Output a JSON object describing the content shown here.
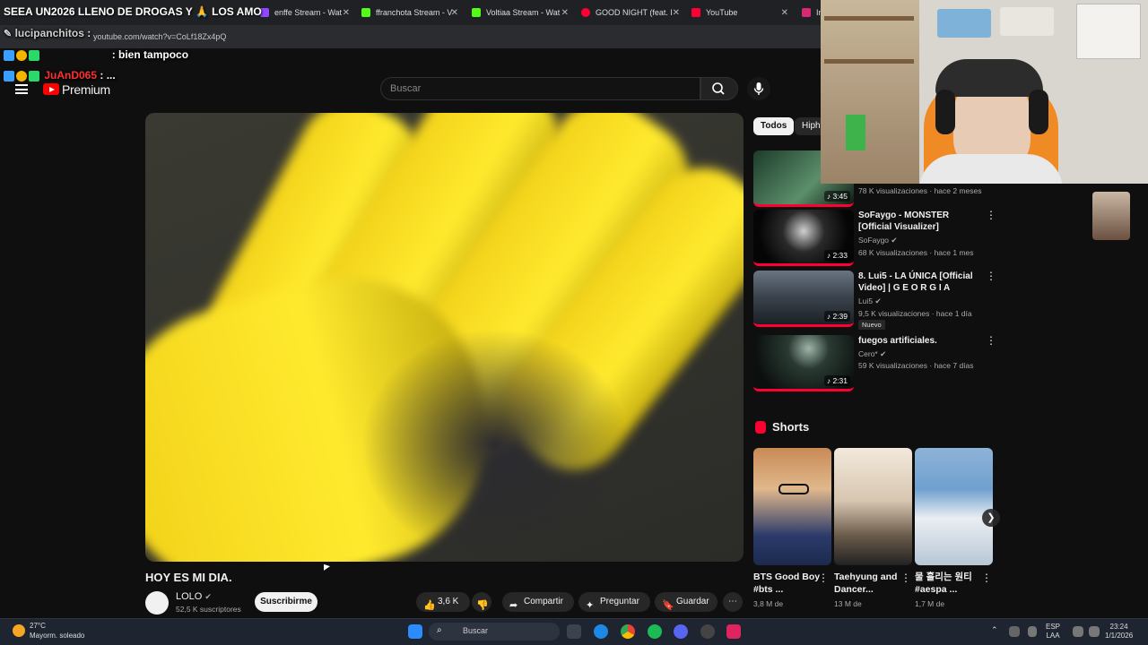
{
  "browser": {
    "stream_title": "SEEA UN2026 LLENO DE DROGAS Y 🙏 LOS AMO",
    "tabs": [
      {
        "label": "enffe Stream - Wat",
        "color": "#9146ff"
      },
      {
        "label": "ffranchota Stream - V",
        "color": "#53fc18"
      },
      {
        "label": "Voltiaa Stream - Wat",
        "color": "#53fc18"
      },
      {
        "label": "GOOD NIGHT (feat. I",
        "color": "#ff0033"
      },
      {
        "label": "YouTube",
        "color": "#ff0033"
      },
      {
        "label": "In",
        "color": "#d62976"
      }
    ],
    "url": "youtube.com/watch?v=CoLf18Zx4pQ"
  },
  "chat": [
    {
      "user": "lucipanchitos",
      "message": ":",
      "user_color": "#d0d0d0"
    },
    {
      "user": "",
      "message": ": bien tampoco",
      "user_color": "#ff3030"
    },
    {
      "user": "JuAnD065",
      "message": ": ...",
      "user_color": "#ff3030"
    }
  ],
  "header": {
    "logo_label": "Premium",
    "search_placeholder": "Buscar"
  },
  "video": {
    "title": "HOY ES MI DIA.",
    "channel": "LOLO",
    "subscribers": "52,5 K suscriptores",
    "subscribe_label": "Suscribirme",
    "likes": "3,6 K",
    "share_label": "Compartir",
    "ask_label": "Preguntar",
    "save_label": "Guardar"
  },
  "chips": [
    "Todos",
    "Hiph"
  ],
  "recommendations": [
    {
      "title": "",
      "channel": "",
      "meta": "78 K visualizaciones · hace 2 meses",
      "duration": "3:45"
    },
    {
      "title": "SoFaygo - MONSTER [Official Visualizer]",
      "channel": "SoFaygo",
      "meta": "68 K visualizaciones · hace 1 mes",
      "duration": "2:33"
    },
    {
      "title": "8. Lui5 - LA ÚNICA [Official Video] | G E O R G I A",
      "channel": "Lui5",
      "meta": "9,5 K visualizaciones · hace 1 día",
      "duration": "2:39",
      "badge": "Nuevo"
    },
    {
      "title": "fuegos artificiales.",
      "channel": "Cero*",
      "meta": "59 K visualizaciones · hace 7 días",
      "duration": "2:31"
    }
  ],
  "shorts": {
    "heading": "Shorts",
    "items": [
      {
        "title": "BTS Good Boy #bts ...",
        "views": "3,8 M de"
      },
      {
        "title": "Taehyung and Dancer...",
        "views": "13 M de"
      },
      {
        "title": "물 흘리는 원티 #aespa ...",
        "views": "1,7 M de"
      }
    ]
  },
  "taskbar": {
    "temperature": "27°C",
    "weather": "Mayorm. soleado",
    "search": "Buscar",
    "lang_1": "ESP",
    "lang_2": "LAA",
    "time": "23:24",
    "date": "1/1/2026"
  }
}
